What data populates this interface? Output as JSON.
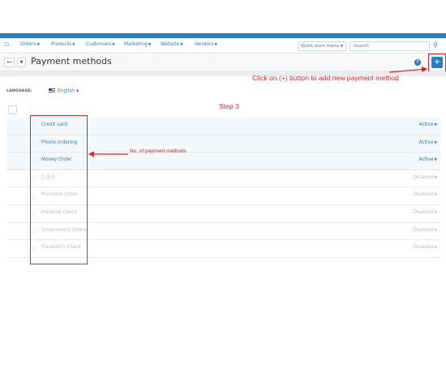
{
  "nav": {
    "menus": [
      {
        "label": "Orders",
        "name": "nav-orders"
      },
      {
        "label": "Products",
        "name": "nav-products"
      },
      {
        "label": "Customers",
        "name": "nav-customers"
      },
      {
        "label": "Marketing",
        "name": "nav-marketing"
      },
      {
        "label": "Website",
        "name": "nav-website"
      },
      {
        "label": "Vendors",
        "name": "nav-vendors"
      }
    ],
    "quick_start": "Quick start menu",
    "search_placeholder": "Search"
  },
  "header": {
    "title": "Payment methods"
  },
  "language": {
    "label": "LANGUAGE:",
    "selected": "English"
  },
  "payment_methods": [
    {
      "name": "Credit card",
      "status": "Active"
    },
    {
      "name": "Phone ordering",
      "status": "Active"
    },
    {
      "name": "Money Order",
      "status": "Active"
    },
    {
      "name": "C.O.D",
      "status": "Disabled"
    },
    {
      "name": "Purchase Order",
      "status": "Disabled"
    },
    {
      "name": "Personal Check",
      "status": "Disabled"
    },
    {
      "name": "Government Check",
      "status": "Disabled"
    },
    {
      "name": "Traveller's Check",
      "status": "Disabled"
    }
  ],
  "annotations": {
    "add_button_hint": "Click on (+) button to add new payment method",
    "step": "Step 3",
    "count_hint": "No. of payment methods",
    "color": "#e0262b"
  },
  "colors": {
    "accent": "#2b7dbe",
    "disabled": "#b9c0c6"
  }
}
